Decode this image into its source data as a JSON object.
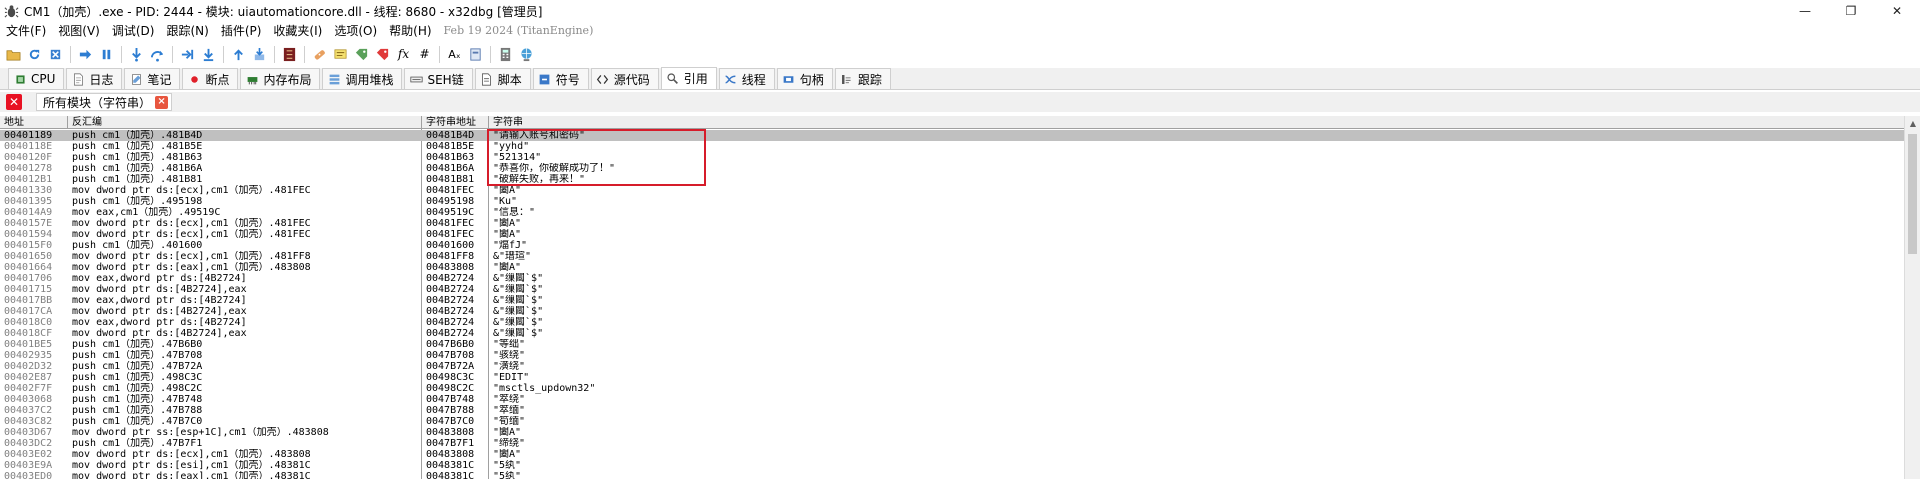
{
  "window": {
    "title": "CM1（加壳）.exe - PID: 2444 - 模块: uiautomationcore.dll - 线程: 8680 - x32dbg [管理员]",
    "minimize": "—",
    "maximize": "❐",
    "close": "✕"
  },
  "menu": {
    "items": [
      "文件(F)",
      "视图(V)",
      "调试(D)",
      "跟踪(N)",
      "插件(P)",
      "收藏夹(I)",
      "选项(O)",
      "帮助(H)"
    ],
    "build": "Feb 19 2024 (TitanEngine)"
  },
  "toolbar": {
    "fx_label": "fx",
    "hash_label": "#",
    "font_label": "Aₓ"
  },
  "tabs": [
    {
      "label": "CPU",
      "icon": "cpu-icon"
    },
    {
      "label": "日志",
      "icon": "log-icon"
    },
    {
      "label": "笔记",
      "icon": "notes-icon"
    },
    {
      "label": "断点",
      "icon": "breakpoint-icon"
    },
    {
      "label": "内存布局",
      "icon": "memory-icon"
    },
    {
      "label": "调用堆栈",
      "icon": "callstack-icon"
    },
    {
      "label": "SEH链",
      "icon": "seh-icon"
    },
    {
      "label": "脚本",
      "icon": "script-icon"
    },
    {
      "label": "符号",
      "icon": "symbol-icon"
    },
    {
      "label": "源代码",
      "icon": "source-icon"
    },
    {
      "label": "引用",
      "icon": "references-icon"
    },
    {
      "label": "线程",
      "icon": "threads-icon"
    },
    {
      "label": "句柄",
      "icon": "handles-icon"
    },
    {
      "label": "跟踪",
      "icon": "trace-icon"
    }
  ],
  "subtab": {
    "label": "所有模块（字符串）",
    "close": "×"
  },
  "columns": [
    "地址",
    "反汇编",
    "字符串地址",
    "字符串"
  ],
  "rows": [
    [
      "00401189",
      "push cm1（加壳）.481B4D",
      "00481B4D",
      "\"请输入账号和密码\""
    ],
    [
      "0040118E",
      "push cm1（加壳）.481B5E",
      "00481B5E",
      "\"yyhd\""
    ],
    [
      "0040120F",
      "push cm1（加壳）.481B63",
      "00481B63",
      "\"521314\""
    ],
    [
      "00401278",
      "push cm1（加壳）.481B6A",
      "00481B6A",
      "\"恭喜你，你破解成功了！\""
    ],
    [
      "004012B1",
      "push cm1（加壳）.481B81",
      "00481B81",
      "\"破解失败，再来！\""
    ],
    [
      "00401330",
      "mov dword ptr ds:[ecx],cm1（加壳）.481FEC",
      "00481FEC",
      "\"闔A\""
    ],
    [
      "00401395",
      "push cm1（加壳）.495198",
      "00495198",
      "\"Ku\""
    ],
    [
      "004014A9",
      "mov eax,cm1（加壳）.49519C",
      "0049519C",
      "\"信息：\""
    ],
    [
      "0040157E",
      "mov dword ptr ds:[ecx],cm1（加壳）.481FEC",
      "00481FEC",
      "\"闔A\""
    ],
    [
      "00401594",
      "mov dword ptr ds:[ecx],cm1（加壳）.481FEC",
      "00481FEC",
      "\"闔A\""
    ],
    [
      "004015F0",
      "push cm1（加壳）.401600",
      "00401600",
      "\"煏fJ\""
    ],
    [
      "00401650",
      "mov dword ptr ds:[ecx],cm1（加壳）.481FF8",
      "00481FF8",
      "&\"瑨瑄\""
    ],
    [
      "00401664",
      "mov dword ptr ds:[eax],cm1（加壳）.483808",
      "00483808",
      "\"闔A\""
    ],
    [
      "00401706",
      "mov eax,dword ptr ds:[4B2724]",
      "004B2724",
      "&\"缫闏`$\""
    ],
    [
      "00401715",
      "mov dword ptr ds:[4B2724],eax",
      "004B2724",
      "&\"缫闏`$\""
    ],
    [
      "004017BB",
      "mov eax,dword ptr ds:[4B2724]",
      "004B2724",
      "&\"缫闏`$\""
    ],
    [
      "004017CA",
      "mov dword ptr ds:[4B2724],eax",
      "004B2724",
      "&\"缫闏`$\""
    ],
    [
      "004018C0",
      "mov eax,dword ptr ds:[4B2724]",
      "004B2724",
      "&\"缫闏`$\""
    ],
    [
      "004018CF",
      "mov dword ptr ds:[4B2724],eax",
      "004B2724",
      "&\"缫闏`$\""
    ],
    [
      "00401BE5",
      "push cm1（加壳）.47B6B0",
      "0047B6B0",
      "\"等绌\""
    ],
    [
      "00402935",
      "push cm1（加壳）.47B708",
      "0047B708",
      "\"骇绕\""
    ],
    [
      "00402D32",
      "push cm1（加壳）.47B72A",
      "0047B72A",
      "\"潢绕\""
    ],
    [
      "00402E87",
      "push cm1（加壳）.498C3C",
      "00498C3C",
      "\"EDIT\""
    ],
    [
      "00402F7F",
      "push cm1（加壳）.498C2C",
      "00498C2C",
      "\"msctls_updown32\""
    ],
    [
      "00403068",
      "push cm1（加壳）.47B748",
      "0047B748",
      "\"箤绕\""
    ],
    [
      "004037C2",
      "push cm1（加壳）.47B788",
      "0047B788",
      "\"箤缅\""
    ],
    [
      "00403C82",
      "push cm1（加壳）.47B7C0",
      "0047B7C0",
      "\"筍缅\""
    ],
    [
      "00403D67",
      "mov dword ptr ss:[esp+1C],cm1（加壳）.483808",
      "00483808",
      "\"闔A\""
    ],
    [
      "00403DC2",
      "push cm1（加壳）.47B7F1",
      "0047B7F1",
      "\"缔绕\""
    ],
    [
      "00403E02",
      "mov dword ptr ds:[ecx],cm1（加壳）.483808",
      "00483808",
      "\"闔A\""
    ],
    [
      "00403E9A",
      "mov dword ptr ds:[esi],cm1（加壳）.48381C",
      "0048381C",
      "\"5纨\""
    ],
    [
      "00403ED0",
      "mov dword ptr ds:[eax],cm1（加壳）.48381C",
      "0048381C",
      "\"5纨\""
    ]
  ],
  "colors": {
    "selected_row": "#c0c0c0",
    "highlight_box": "#d61c2a",
    "address_gray": "#808080"
  }
}
